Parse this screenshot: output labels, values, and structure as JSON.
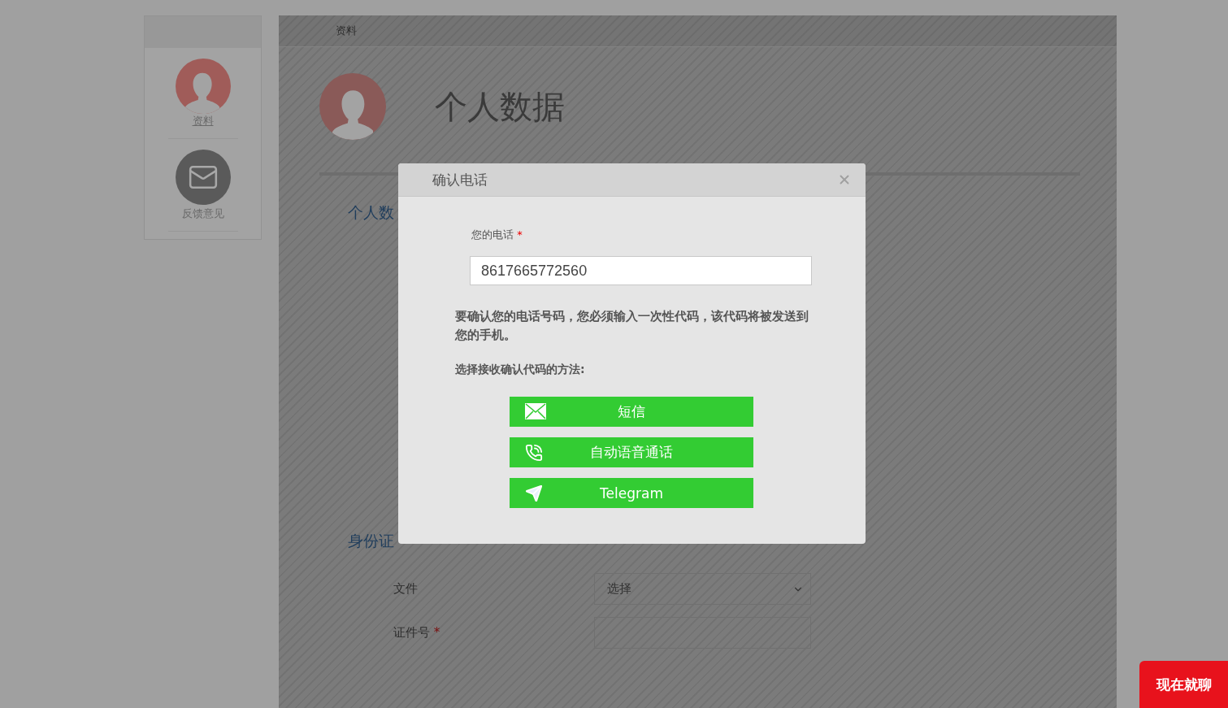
{
  "sidebar": {
    "items": [
      {
        "kind": "avatar",
        "label": "资料",
        "selected": true
      },
      {
        "kind": "feedback",
        "label": "反馈意见",
        "selected": false
      }
    ]
  },
  "breadcrumb": "资料",
  "page_title": "个人数据",
  "sections": [
    {
      "title": "个人数"
    },
    {
      "title": "身份证"
    }
  ],
  "id_form": {
    "fields": [
      {
        "kind": "select",
        "label": "文件",
        "placeholder": "选择"
      },
      {
        "kind": "input",
        "label": "证件号",
        "required_mark": "*"
      }
    ]
  },
  "dialog": {
    "title": "确认电话",
    "phone_label": "您的电话",
    "phone_required_mark": "*",
    "phone_value": "8617665772560",
    "message": "要确认您的电话号码，您必须输入一次性代码，该代码将被发送到您的手机。",
    "method_prompt": "选择接收确认代码的方法:",
    "methods": [
      {
        "kind": "sms",
        "label": "短信"
      },
      {
        "kind": "voice",
        "label": "自动语音通话"
      },
      {
        "kind": "telegram",
        "label": "Telegram"
      }
    ]
  },
  "chat_button": "现在就聊"
}
